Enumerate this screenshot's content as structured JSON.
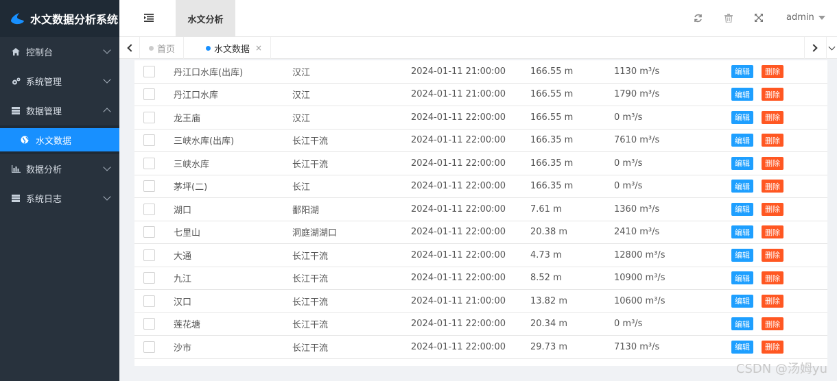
{
  "app": {
    "title": "水文数据分析系统"
  },
  "sidebar": {
    "items": [
      {
        "label": "控制台",
        "icon": "home-icon"
      },
      {
        "label": "系统管理",
        "icon": "gears-icon"
      },
      {
        "label": "数据管理",
        "icon": "server-icon"
      },
      {
        "label": "数据分析",
        "icon": "bar-chart-icon"
      },
      {
        "label": "系统日志",
        "icon": "server-icon"
      }
    ],
    "submenu": {
      "label": "水文数据",
      "icon": "globe-icon"
    }
  },
  "header": {
    "active_tab": "水文分析",
    "user": "admin"
  },
  "tabs": [
    {
      "label": "首页"
    },
    {
      "label": "水文数据",
      "close": "×"
    }
  ],
  "table": {
    "rows": [
      {
        "name": "丹江口水库(出库)",
        "river": "汉江",
        "time": "2024-01-11 21:00:00",
        "level": "166.55 m",
        "flow": "1130 m³/s"
      },
      {
        "name": "丹江口水库",
        "river": "汉江",
        "time": "2024-01-11 21:00:00",
        "level": "166.55 m",
        "flow": "1790 m³/s"
      },
      {
        "name": "龙王庙",
        "river": "汉江",
        "time": "2024-01-11 22:00:00",
        "level": "166.55 m",
        "flow": "0 m³/s"
      },
      {
        "name": "三峡水库(出库)",
        "river": "长江干流",
        "time": "2024-01-11 22:00:00",
        "level": "166.35 m",
        "flow": "7610 m³/s"
      },
      {
        "name": "三峡水库",
        "river": "长江干流",
        "time": "2024-01-11 22:00:00",
        "level": "166.35 m",
        "flow": "0 m³/s"
      },
      {
        "name": "茅坪(二)",
        "river": "长江",
        "time": "2024-01-11 22:00:00",
        "level": "166.35 m",
        "flow": "0 m³/s"
      },
      {
        "name": "湖口",
        "river": "鄱阳湖",
        "time": "2024-01-11 22:00:00",
        "level": "7.61 m",
        "flow": "1360 m³/s"
      },
      {
        "name": "七里山",
        "river": "洞庭湖湖口",
        "time": "2024-01-11 22:00:00",
        "level": "20.38 m",
        "flow": "2410 m³/s"
      },
      {
        "name": "大通",
        "river": "长江干流",
        "time": "2024-01-11 22:00:00",
        "level": "4.73 m",
        "flow": "12800 m³/s"
      },
      {
        "name": "九江",
        "river": "长江干流",
        "time": "2024-01-11 22:00:00",
        "level": "8.52 m",
        "flow": "10900 m³/s"
      },
      {
        "name": "汉口",
        "river": "长江干流",
        "time": "2024-01-11 21:00:00",
        "level": "13.82 m",
        "flow": "10600 m³/s"
      },
      {
        "name": "莲花塘",
        "river": "长江干流",
        "time": "2024-01-11 22:00:00",
        "level": "20.34 m",
        "flow": "0 m³/s"
      },
      {
        "name": "沙市",
        "river": "长江干流",
        "time": "2024-01-11 22:00:00",
        "level": "29.73 m",
        "flow": "7130 m³/s"
      }
    ],
    "edit_label": "编辑",
    "delete_label": "删除"
  },
  "watermark": "CSDN @汤姆yu"
}
